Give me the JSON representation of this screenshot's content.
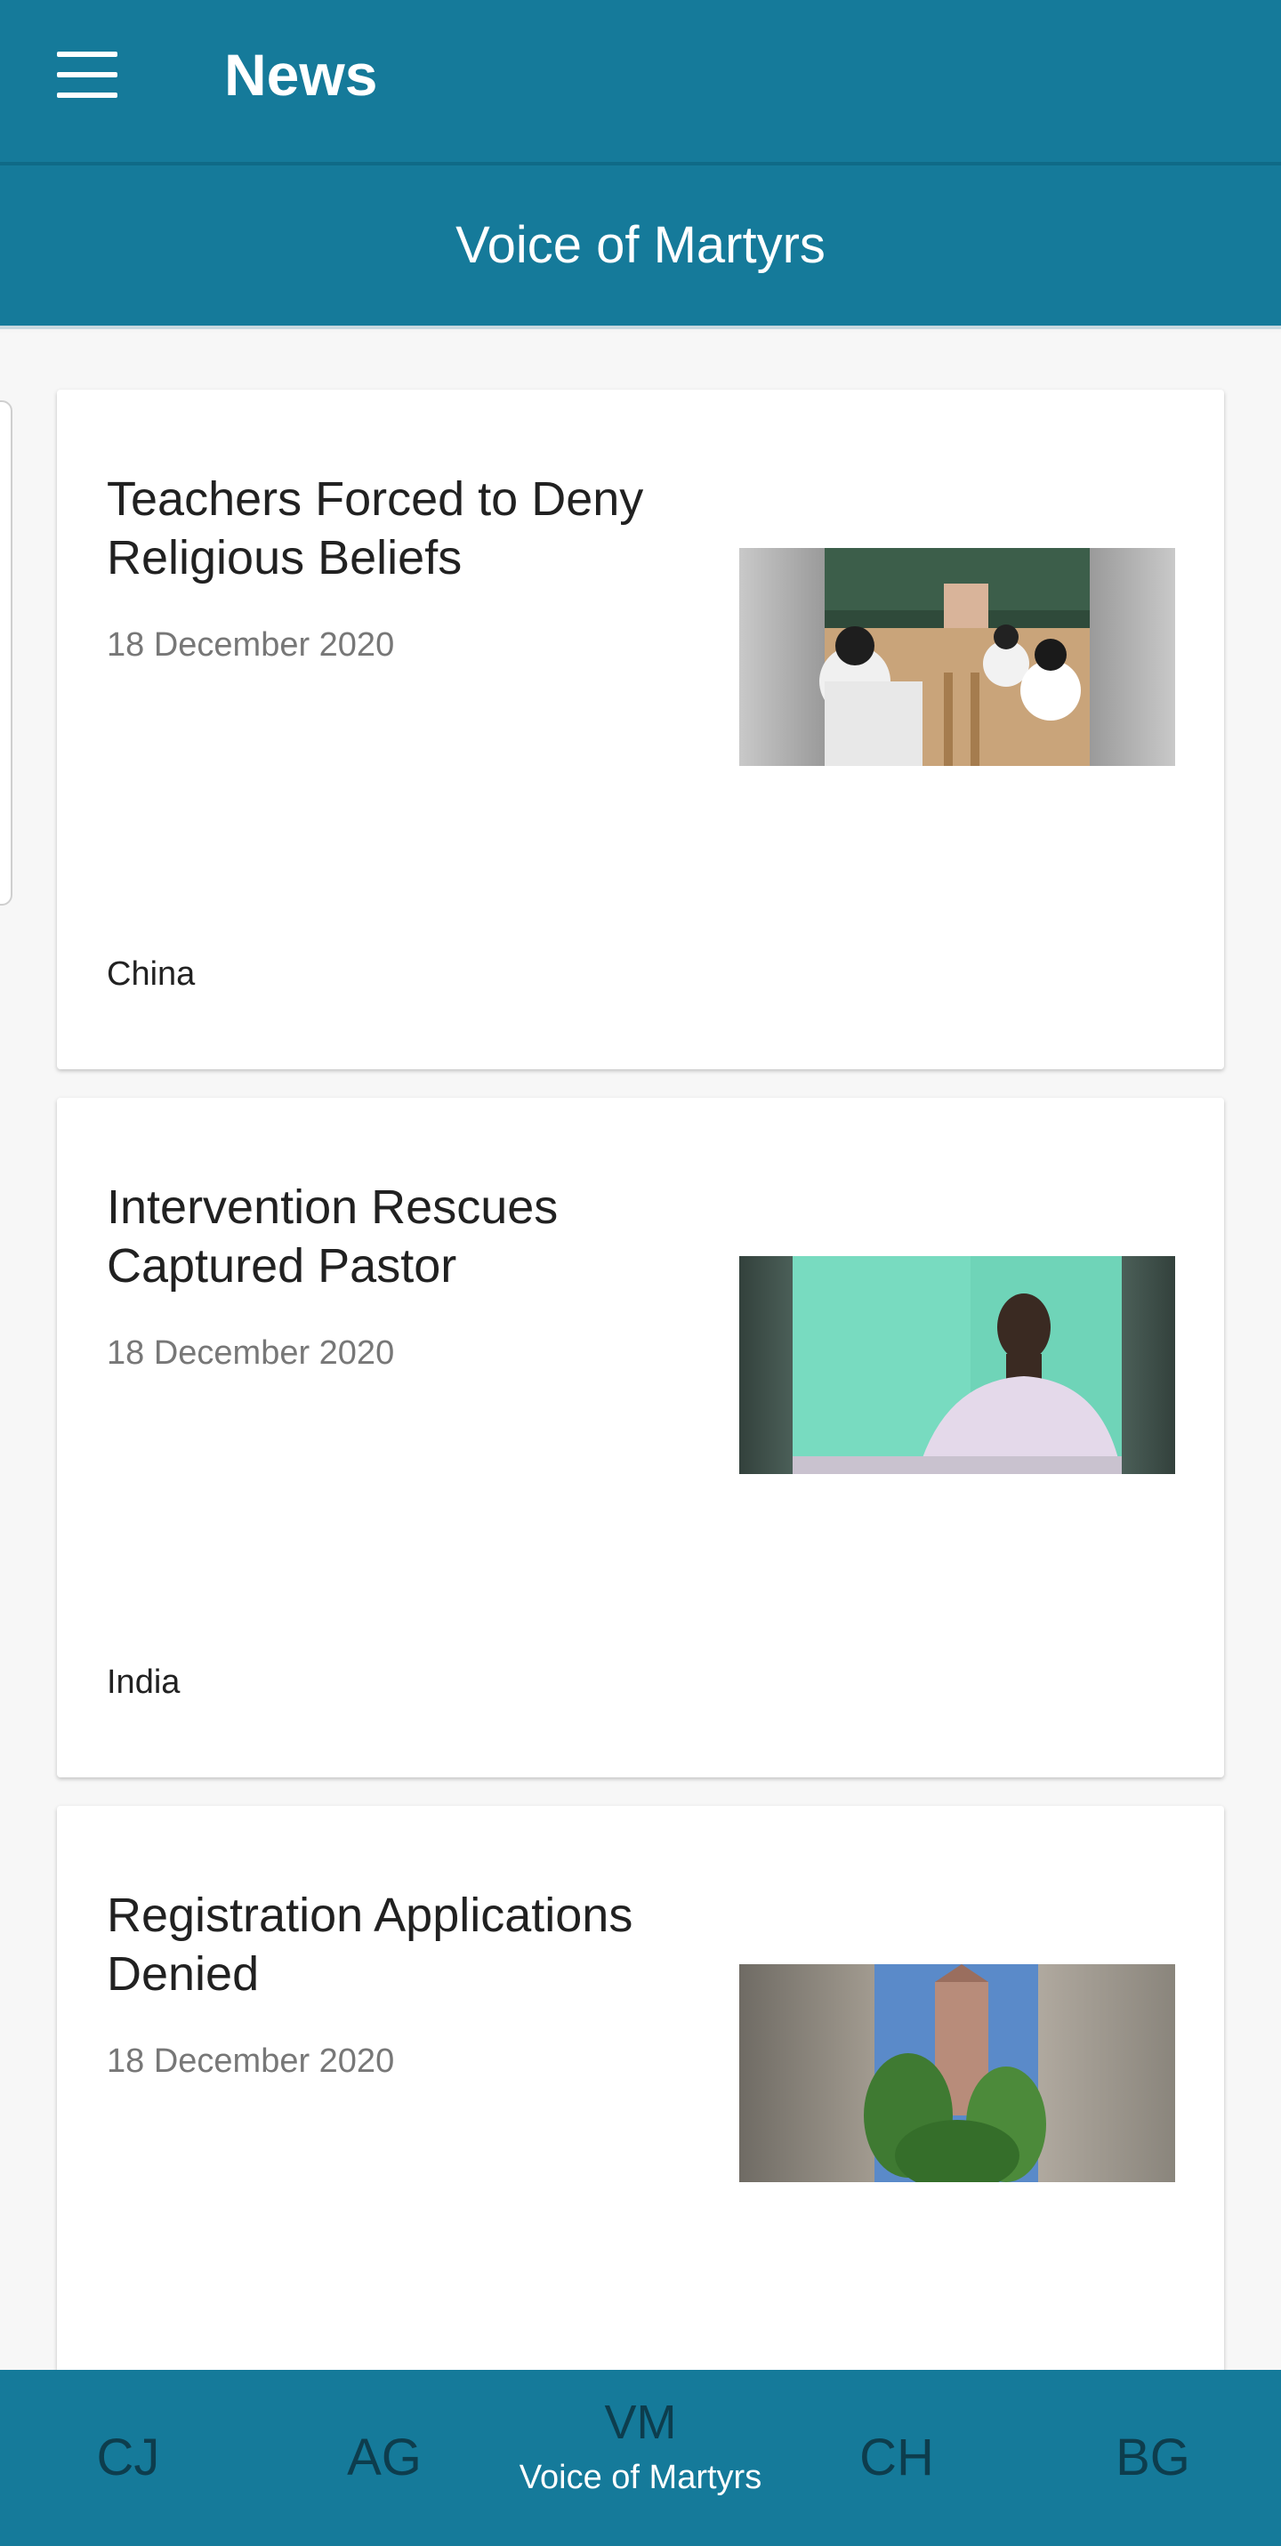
{
  "appbar": {
    "title": "News",
    "menu_icon": "hamburger-menu-icon"
  },
  "subheader": {
    "title": "Voice of Martyrs"
  },
  "articles": [
    {
      "title": "Teachers Forced to Deny Religious Beliefs",
      "date": "18 December 2020",
      "region": "China"
    },
    {
      "title": "Intervention Rescues Captured Pastor",
      "date": "18 December 2020",
      "region": "India"
    },
    {
      "title": "Registration Applications Denied",
      "date": "18 December 2020",
      "region": ""
    }
  ],
  "bottom_nav": {
    "items": [
      {
        "code": "CJ",
        "label": ""
      },
      {
        "code": "AG",
        "label": ""
      },
      {
        "code": "VM",
        "label": "Voice of Martyrs"
      },
      {
        "code": "CH",
        "label": ""
      },
      {
        "code": "BG",
        "label": ""
      }
    ],
    "active_index": 2
  },
  "colors": {
    "primary": "#157a9a",
    "inactive_nav": "#0d3d4d"
  }
}
